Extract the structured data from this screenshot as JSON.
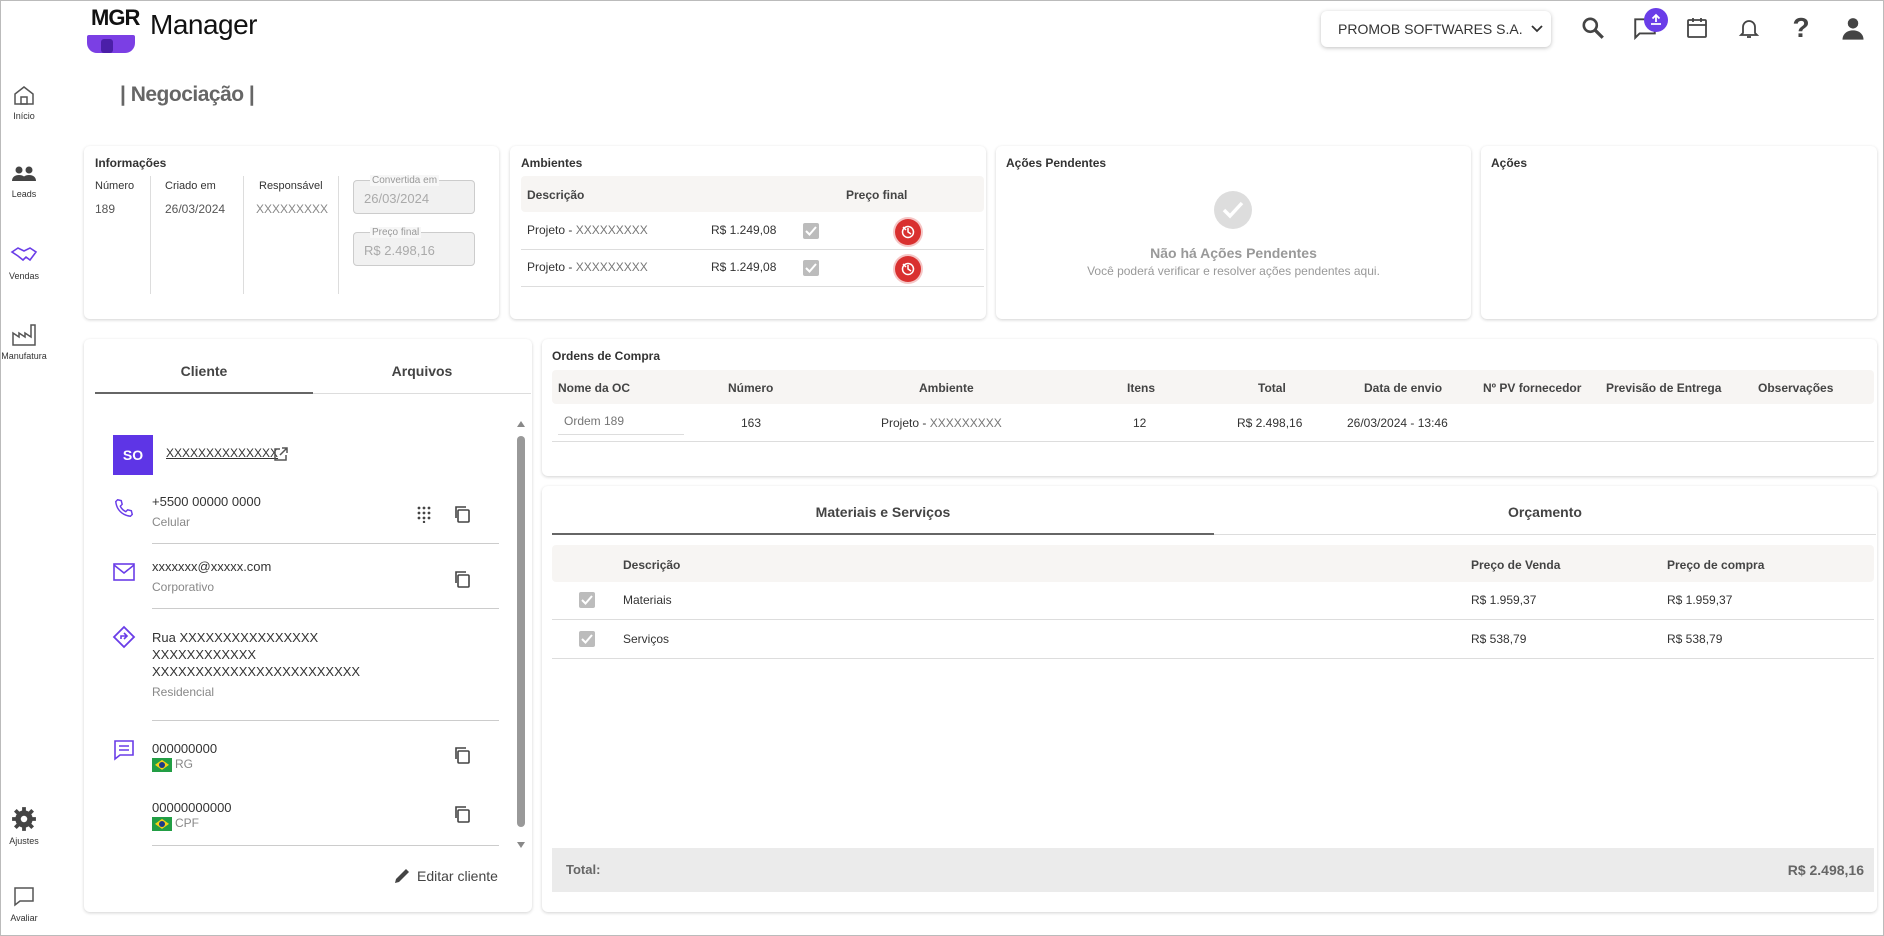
{
  "app": {
    "logo_text": "MGR",
    "title": "Manager"
  },
  "header": {
    "company": "PROMOB SOFTWARES S.A.",
    "upload_badge": "↑"
  },
  "sidebar": {
    "items": [
      {
        "label": "Início"
      },
      {
        "label": "Leads"
      },
      {
        "label": "Vendas"
      },
      {
        "label": "Manufatura"
      },
      {
        "label": "Ajustes"
      },
      {
        "label": "Avaliar"
      }
    ]
  },
  "page": {
    "title": "| Negociação |"
  },
  "info": {
    "title": "Informações",
    "numero_label": "Número",
    "numero": "189",
    "criado_label": "Criado em",
    "criado": "26/03/2024",
    "responsavel_label": "Responsável",
    "responsavel": "XXXXXXXXX",
    "convertida_label": "Convertida em",
    "convertida": "26/03/2024",
    "preco_label": "Preço final",
    "preco": "R$ 2.498,16"
  },
  "ambientes": {
    "title": "Ambientes",
    "col_desc": "Descrição",
    "col_preco": "Preço final",
    "rows": [
      {
        "prefix": "Projeto - ",
        "name": "XXXXXXXXX",
        "price": "R$ 1.249,08"
      },
      {
        "prefix": "Projeto - ",
        "name": "XXXXXXXXX",
        "price": "R$ 1.249,08"
      }
    ]
  },
  "acoes_pendentes": {
    "title": "Ações Pendentes",
    "empty_title": "Não há Ações Pendentes",
    "empty_sub": "Você poderá verificar e resolver ações pendentes aqui."
  },
  "acoes": {
    "title": "Ações"
  },
  "cliente_tabs": {
    "cliente": "Cliente",
    "arquivos": "Arquivos"
  },
  "cliente": {
    "initials": "SO",
    "name": "XXXXXXXXXXXXXX",
    "phone": "+5500 00000 0000",
    "phone_type": "Celular",
    "email": "xxxxxxx@xxxxx.com",
    "email_type": "Corporativo",
    "address_l1": "Rua XXXXXXXXXXXXXXXX",
    "address_l2": "XXXXXXXXXXXX",
    "address_l3": "XXXXXXXXXXXXXXXXXXXXXXXX",
    "address_type": "Residencial",
    "rg": "000000000",
    "rg_label": "RG",
    "cpf": "00000000000",
    "cpf_label": "CPF",
    "edit_label": "Editar cliente"
  },
  "ordens": {
    "title": "Ordens de Compra",
    "cols": [
      "Nome da OC",
      "Número",
      "Ambiente",
      "Itens",
      "Total",
      "Data de envio",
      "Nº PV fornecedor",
      "Previsão de Entrega",
      "Observações"
    ],
    "row": {
      "oc_placeholder": "Ordem 189",
      "numero": "163",
      "amb_prefix": "Projeto - ",
      "amb_name": "XXXXXXXXX",
      "itens": "12",
      "total": "R$ 2.498,16",
      "data": "26/03/2024 - 13:46"
    }
  },
  "materiais_tabs": {
    "materiais": "Materiais e Serviços",
    "orcamento": "Orçamento"
  },
  "materiais": {
    "col_desc": "Descrição",
    "col_venda": "Preço de Venda",
    "col_compra": "Preço de compra",
    "rows": [
      {
        "desc": "Materiais",
        "venda": "R$ 1.959,37",
        "compra": "R$ 1.959,37"
      },
      {
        "desc": "Serviços",
        "venda": "R$ 538,79",
        "compra": "R$ 538,79"
      }
    ],
    "total_label": "Total:",
    "total_value": "R$ 2.498,16"
  },
  "colors": {
    "accent": "#6a3de8",
    "delete": "#d9302f"
  }
}
